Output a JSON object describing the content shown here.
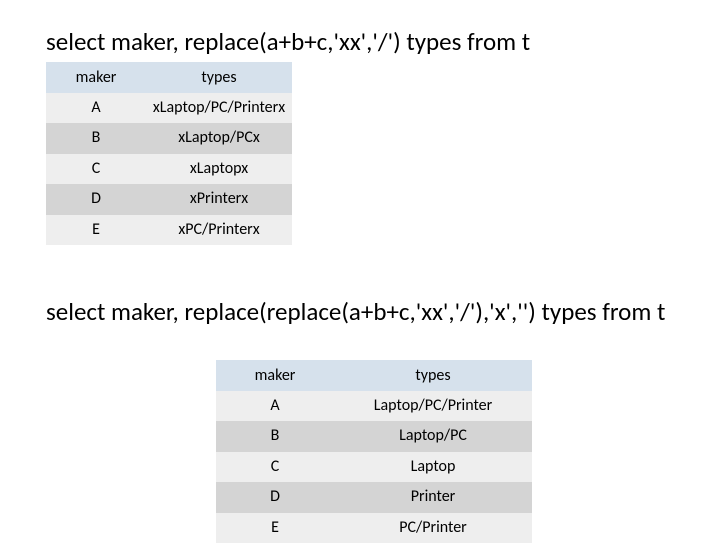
{
  "query1": "select maker, replace(a+b+c,'xx','/') types from t",
  "query2": "select maker, replace(replace(a+b+c,'xx','/'),'x','') types from t",
  "table1": {
    "headers": {
      "maker": "maker",
      "types": "types"
    },
    "rows": [
      {
        "maker": "A",
        "types": "xLaptop/PC/Printerx"
      },
      {
        "maker": "B",
        "types": "xLaptop/PCx"
      },
      {
        "maker": "C",
        "types": "xLaptopx"
      },
      {
        "maker": "D",
        "types": "xPrinterx"
      },
      {
        "maker": "E",
        "types": "xPC/Printerx"
      }
    ]
  },
  "table2": {
    "headers": {
      "maker": "maker",
      "types": "types"
    },
    "rows": [
      {
        "maker": "A",
        "types": "Laptop/PC/Printer"
      },
      {
        "maker": "B",
        "types": "Laptop/PC"
      },
      {
        "maker": "C",
        "types": "Laptop"
      },
      {
        "maker": "D",
        "types": "Printer"
      },
      {
        "maker": "E",
        "types": "PC/Printer"
      }
    ]
  }
}
